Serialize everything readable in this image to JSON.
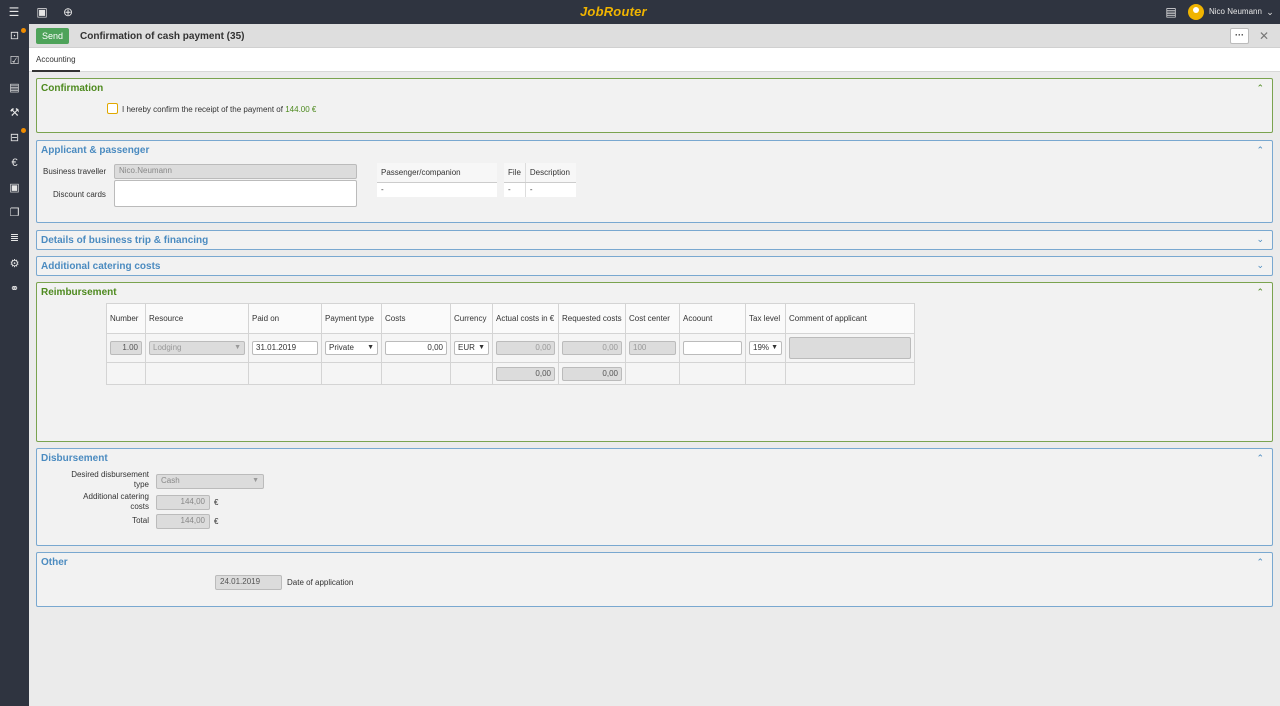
{
  "app": {
    "logo": "JobRouter"
  },
  "topbar": {
    "user_name": "Nico Neumann",
    "icons": [
      "menu-icon",
      "bookmark-icon",
      "add-icon",
      "clipboard-icon",
      "chevron-down-icon"
    ]
  },
  "header": {
    "send_label": "Send",
    "title": "Confirmation of cash payment (35)",
    "more_label": "···",
    "close_label": "✕"
  },
  "tabs": [
    {
      "label": "Accounting"
    }
  ],
  "confirmation": {
    "title": "Confirmation",
    "text": "I hereby confirm the receipt of the payment of",
    "amount": "144.00 €"
  },
  "applicant": {
    "title": "Applicant & passenger",
    "business_traveller_label": "Business traveller",
    "business_traveller_value": "Nico.Neumann",
    "discount_cards_label": "Discount cards",
    "passenger_header": "Passenger/companion",
    "passenger_value": "-",
    "file_header": "File",
    "file_value": "-",
    "description_header": "Description",
    "description_value": "-"
  },
  "details": {
    "title": "Details of business trip & financing"
  },
  "catering": {
    "title": "Additional catering costs"
  },
  "reimbursement": {
    "title": "Reimbursement",
    "columns": [
      "Number",
      "Resource",
      "Paid on",
      "Payment type",
      "Costs",
      "Currency",
      "Actual costs in €",
      "Requested costs",
      "Cost center",
      "Acoount",
      "Tax level",
      "Comment of applicant"
    ],
    "row": {
      "number": "1.00",
      "resource": "Lodging",
      "paid_on": "31.01.2019",
      "payment_type": "Private",
      "costs": "0,00",
      "currency": "EUR",
      "actual_costs": "0,00",
      "requested_costs": "0,00",
      "cost_center": "100",
      "account": "",
      "tax_level": "19%",
      "comment": ""
    },
    "totals": {
      "actual_costs": "0,00",
      "requested_costs": "0,00"
    }
  },
  "disbursement": {
    "title": "Disbursement",
    "type_label": "Desired disbursement type",
    "type_value": "Cash",
    "catering_label": "Additional catering costs",
    "catering_value": "144,00",
    "total_label": "Total",
    "total_value": "144,00",
    "currency_symbol": "€"
  },
  "other": {
    "title": "Other",
    "date_value": "24.01.2019",
    "date_label": "Date of application"
  },
  "colors": {
    "accent_blue": "#4b8bc0",
    "accent_green": "#4e8a1f",
    "send_button": "#4ea35a",
    "logo": "#f0b400",
    "topbar": "#2f3440"
  }
}
